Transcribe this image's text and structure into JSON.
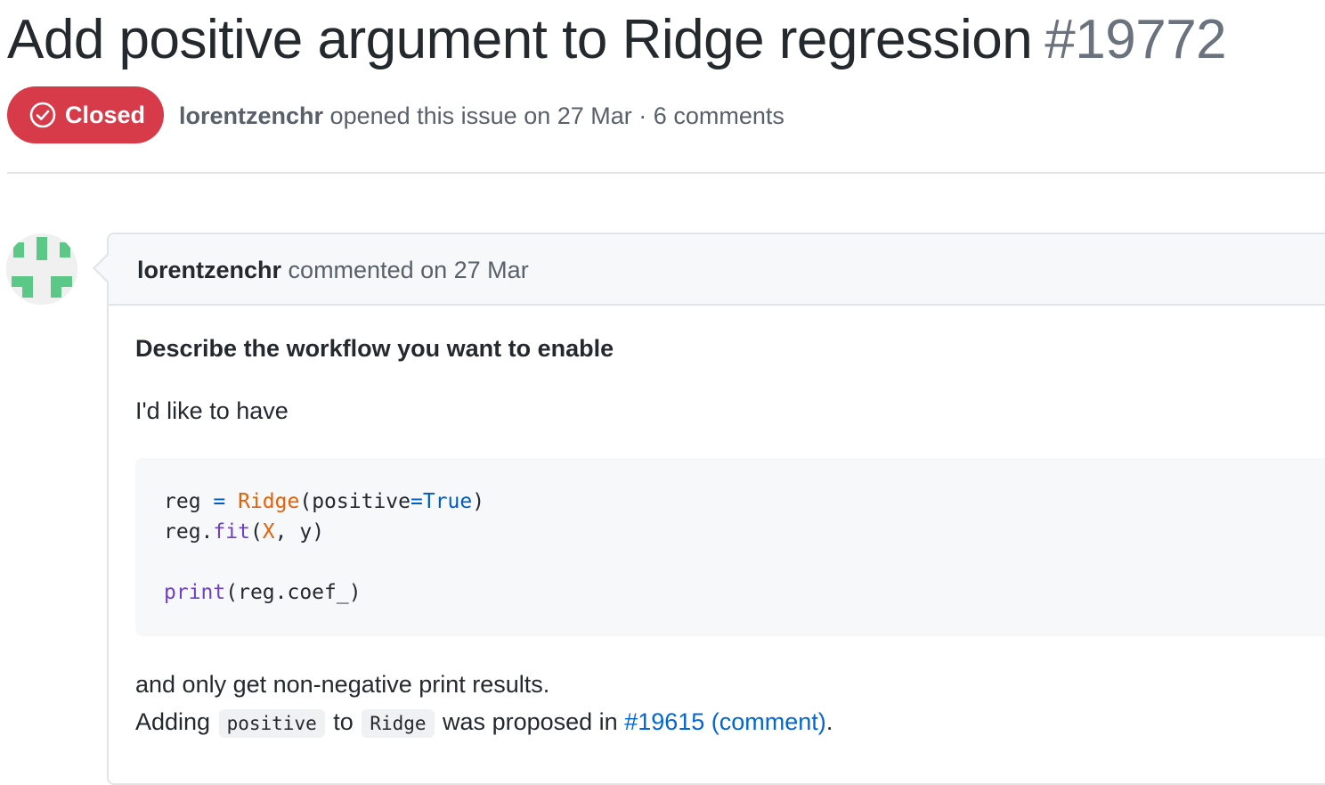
{
  "issue": {
    "title": "Add positive argument to Ridge regression",
    "number": "#19772",
    "state": "Closed",
    "author": "lorentzenchr",
    "opened_text": "opened this issue on 27 Mar",
    "separator": "·",
    "comments_count": "6 comments"
  },
  "comment": {
    "author": "lorentzenchr",
    "commented_text": "commented on 27 Mar",
    "heading": "Describe the workflow you want to enable",
    "intro": "I'd like to have",
    "code": {
      "line1": {
        "a": "reg ",
        "b": "=",
        "c": " ",
        "d": "Ridge",
        "e": "(positive",
        "f": "=",
        "g": "True",
        "h": ")"
      },
      "line2": {
        "a": "reg.",
        "b": "fit",
        "c": "(",
        "d": "X",
        "e": ", y)"
      },
      "line3": {
        "a": "print",
        "b": "(reg.coef_)"
      }
    },
    "after_code": "and only get non-negative print results.",
    "adding_prefix": "Adding",
    "code_positive": "positive",
    "to_text": "to",
    "code_ridge": "Ridge",
    "proposed_text": "was proposed in",
    "link_text": "#19615 (comment)",
    "end_period": "."
  },
  "colors": {
    "closed_badge": "#d73a49",
    "link": "#0366d6",
    "avatar_green": "#5cc887"
  }
}
